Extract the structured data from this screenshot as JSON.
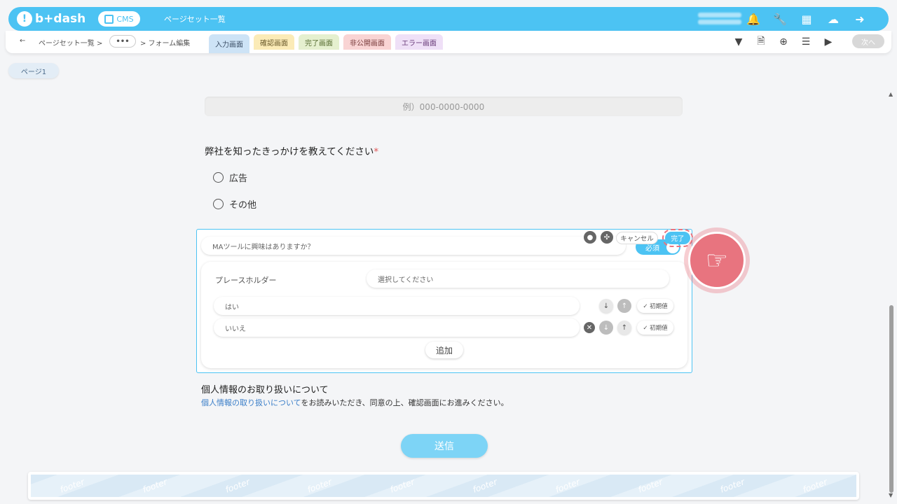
{
  "header": {
    "logo_text": "b+dash",
    "logo_mark": "!",
    "cms_label": "CMS",
    "title": "ページセット一覧",
    "icons": [
      "bell-icon",
      "wrench-icon",
      "apps-grid-icon",
      "support-bot-icon",
      "logout-icon"
    ]
  },
  "subbar": {
    "back_arrow": "←",
    "crumb_1": "ページセット一覧 >",
    "crumb_more": "•••",
    "crumb_2": "> フォーム編集",
    "tabs": [
      {
        "label": "入力画面"
      },
      {
        "label": "確認画面"
      },
      {
        "label": "完了画面"
      },
      {
        "label": "非公開画面"
      },
      {
        "label": "エラー画面"
      }
    ],
    "next_label": "次へ"
  },
  "page_chip": "ページ1",
  "form": {
    "phone_placeholder": "例）000-0000-0000",
    "question_label": "弊社を知ったきっかけを教えてください",
    "required_mark": "*",
    "radio_options": [
      "広告",
      "その他"
    ]
  },
  "edit_panel": {
    "title_value": "MAツールに興味はありますか？",
    "required_label": "必須",
    "cancel_label": "キャンセル",
    "done_label": "完了",
    "placeholder_label": "プレースホルダー",
    "placeholder_value": "選択してください",
    "options": [
      {
        "value": "はい",
        "init_label": "✓ 初期値"
      },
      {
        "value": "いいえ",
        "init_label": "✓ 初期値"
      }
    ],
    "add_label": "追加"
  },
  "privacy": {
    "title": "個人情報のお取り扱いについて",
    "link_text": "個人情報の取り扱いについて",
    "text": "をお読みいただき、同意の上、確認画面にお進みください。"
  },
  "submit_label": "送信",
  "footer_label": "footer"
}
